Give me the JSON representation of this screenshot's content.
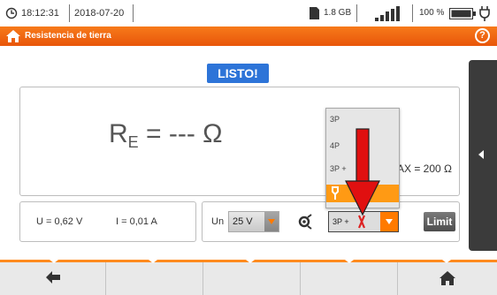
{
  "status": {
    "time": "18:12:31",
    "date": "2018-07-20",
    "storage": "1.8 GB",
    "battery": "100 %"
  },
  "header": {
    "title": "Resistencia de tierra",
    "help_icon": "?"
  },
  "state_label": "LISTO!",
  "measurement": {
    "symbol": "R",
    "subscript": "E",
    "value": " = --- Ω",
    "range_max": "AX = 200 Ω"
  },
  "readings": {
    "voltage": "U = 0,62 V",
    "current": "I = 0,01 A"
  },
  "controls": {
    "un_label": "Un",
    "un_value": "25 V",
    "mode_value": "3P +",
    "limit_label": "Limit"
  },
  "dropdown": {
    "items": [
      "3P",
      "4P",
      "3P +",
      ""
    ]
  },
  "colors": {
    "accent": "#f0650f",
    "state_blue": "#2d74d8",
    "arrow_red": "#e01010"
  },
  "icons": {
    "clock": "clock-icon",
    "sd_card": "sd-card-icon",
    "signal": "signal-icon",
    "battery": "battery-icon",
    "plug": "plug-icon",
    "home": "home-icon",
    "help": "help-icon",
    "back": "back-arrow-icon",
    "clamp": "clamp-icon"
  }
}
